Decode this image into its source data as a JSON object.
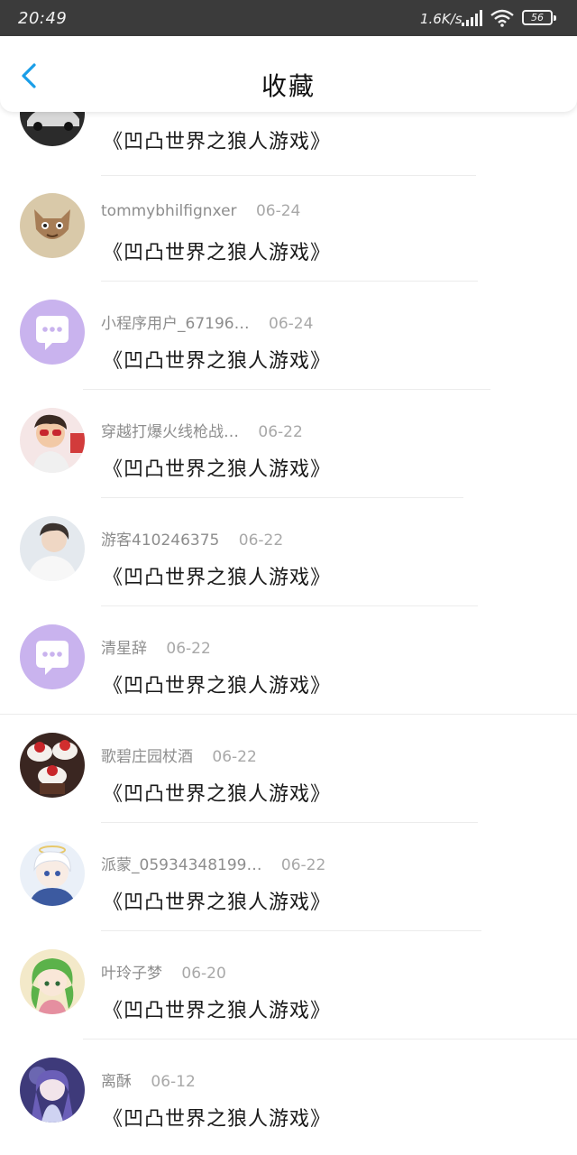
{
  "status_bar": {
    "time": "20:49",
    "net_speed": "1.6K/s",
    "battery": "56"
  },
  "header": {
    "title": "收藏"
  },
  "colors": {
    "accent": "#1a9ee8",
    "default_avatar": "#c9b3ee"
  },
  "items": [
    {
      "name": "",
      "date": "",
      "game": "《凹凸世界之狼人游戏》",
      "avatar": "car-photo"
    },
    {
      "name": "tommybhilfignxer",
      "date": "06-24",
      "game": "《凹凸世界之狼人游戏》",
      "avatar": "cat-cartoon"
    },
    {
      "name": "小程序用户_67196…",
      "date": "06-24",
      "game": "《凹凸世界之狼人游戏》",
      "avatar": "chat-bubble-icon"
    },
    {
      "name": "穿越打爆火线枪战…",
      "date": "06-22",
      "game": "《凹凸世界之狼人游戏》",
      "avatar": "boy-sunglasses"
    },
    {
      "name": "游客410246375",
      "date": "06-22",
      "game": "《凹凸世界之狼人游戏》",
      "avatar": "young-man"
    },
    {
      "name": "清星辞",
      "date": "06-22",
      "game": "《凹凸世界之狼人游戏》",
      "avatar": "chat-bubble-icon"
    },
    {
      "name": "歌碧庄园杖酒",
      "date": "06-22",
      "game": "《凹凸世界之狼人游戏》",
      "avatar": "cupcakes"
    },
    {
      "name": "派蒙_05934348199…",
      "date": "06-22",
      "game": "《凹凸世界之狼人游戏》",
      "avatar": "anime-white-hair"
    },
    {
      "name": "叶玲子梦",
      "date": "06-20",
      "game": "《凹凸世界之狼人游戏》",
      "avatar": "anime-green-hair"
    },
    {
      "name": "离酥",
      "date": "06-12",
      "game": "《凹凸世界之狼人游戏》",
      "avatar": "anime-purple"
    }
  ]
}
